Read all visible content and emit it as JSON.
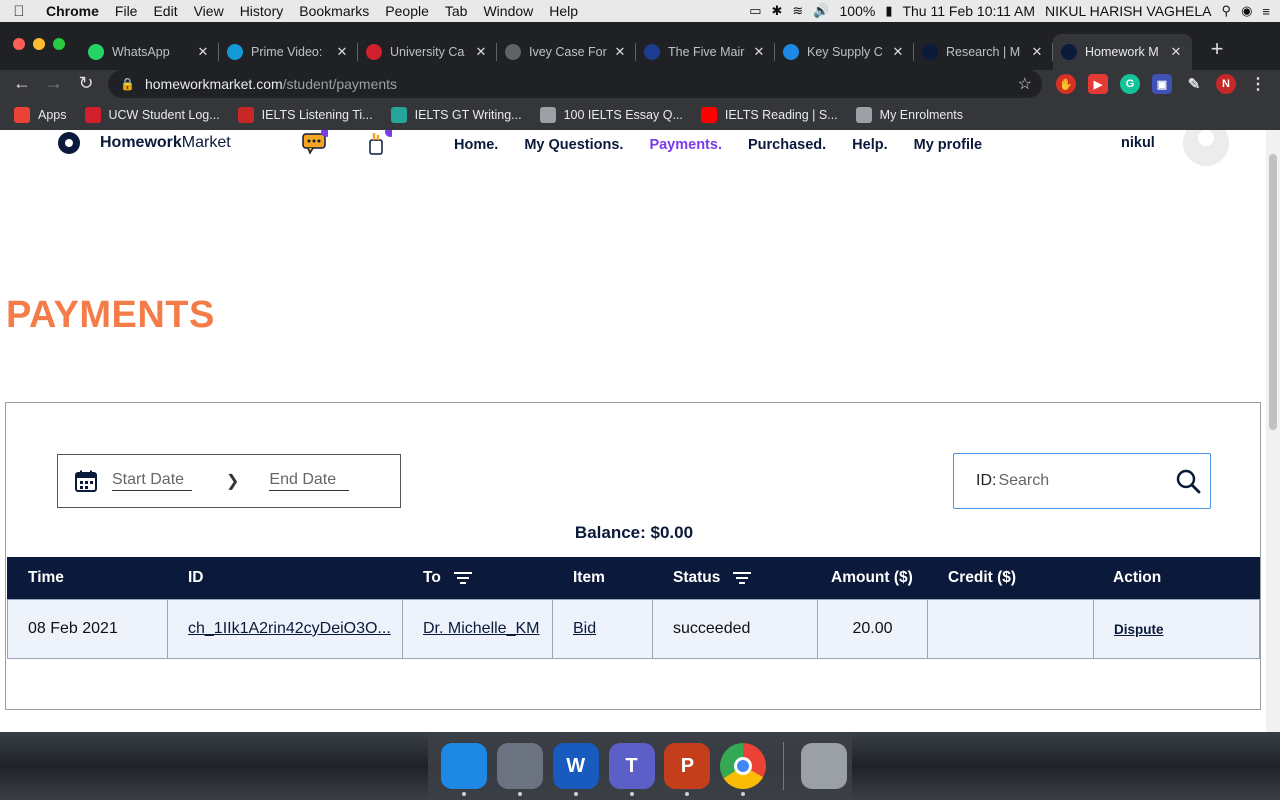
{
  "menubar": {
    "app": "Chrome",
    "items": [
      "File",
      "Edit",
      "View",
      "History",
      "Bookmarks",
      "People",
      "Tab",
      "Window",
      "Help"
    ],
    "battery": "100%",
    "datetime": "Thu 11 Feb  10:11 AM",
    "user": "NIKUL HARISH VAGHELA"
  },
  "tabs": [
    {
      "title": "WhatsApp",
      "color": "#25d366",
      "icon": "whatsapp-icon"
    },
    {
      "title": "Prime Video:",
      "color": "#1399d6",
      "icon": "prime-video-icon"
    },
    {
      "title": "University Ca",
      "color": "#d11f2e",
      "icon": "university-icon"
    },
    {
      "title": "Ivey Case For",
      "color": "#5f6368",
      "icon": "globe-icon"
    },
    {
      "title": "The Five Mair",
      "color": "#1c3d8f",
      "icon": "hbr-icon"
    },
    {
      "title": "Key Supply C",
      "color": "#1e88e5",
      "icon": "sphere-icon"
    },
    {
      "title": "Research | M",
      "color": "#0b1a3a",
      "icon": "homework-icon"
    },
    {
      "title": "Homework M",
      "color": "#0b1a3a",
      "icon": "homework-icon",
      "active": true
    }
  ],
  "address": {
    "domain": "homeworkmarket.com",
    "path": "/student/payments"
  },
  "bookmarks": [
    {
      "label": "Apps",
      "color": "#ea4335"
    },
    {
      "label": "UCW Student Log...",
      "color": "#d11f2e"
    },
    {
      "label": "IELTS Listening Ti...",
      "color": "#c62828"
    },
    {
      "label": "IELTS GT Writing...",
      "color": "#26a69a"
    },
    {
      "label": "100 IELTS Essay Q...",
      "color": "#9aa0a6"
    },
    {
      "label": "IELTS Reading | S...",
      "color": "#ff0000"
    },
    {
      "label": "My Enrolments",
      "color": "#9aa0a6"
    }
  ],
  "site": {
    "logo_bold": "Homework",
    "logo_rest": "Market",
    "nav": [
      "Home.",
      "My Questions.",
      "Payments.",
      "Purchased.",
      "Help.",
      "My profile"
    ],
    "active_nav": "Payments.",
    "username": "nikul"
  },
  "payments": {
    "title": "PAYMENTS",
    "start_date_placeholder": "Start Date",
    "end_date_placeholder": "End Date",
    "search_label": "ID:",
    "search_placeholder": "Search",
    "balance": "Balance: $0.00",
    "columns": [
      "Time",
      "ID",
      "To",
      "Item",
      "Status",
      "Amount ($)",
      "Credit ($)",
      "Action"
    ],
    "rows": [
      {
        "time": "08 Feb 2021",
        "id": "ch_1IIk1A2rin42cyDeiO3O...",
        "to": "Dr. Michelle_KM",
        "item": "Bid",
        "status": "succeeded",
        "amount": "20.00",
        "credit": "",
        "action": "Dispute"
      }
    ]
  },
  "dock": [
    {
      "name": "finder",
      "color": "#1e88e5"
    },
    {
      "name": "launchpad",
      "color": "#6b7280"
    },
    {
      "name": "word",
      "color": "#185abd",
      "glyph": "W"
    },
    {
      "name": "teams",
      "color": "#5b5fc7",
      "glyph": "T"
    },
    {
      "name": "powerpoint",
      "color": "#c43e1c",
      "glyph": "P"
    },
    {
      "name": "chrome",
      "color": "#ffffff"
    },
    {
      "name": "trash",
      "color": "#9aa0a6"
    }
  ],
  "colors": {
    "brand_navy": "#0b1a3a",
    "title_orange": "#f37c49",
    "nav_active": "#7c3aed",
    "row_bg": "#eef2fb"
  }
}
